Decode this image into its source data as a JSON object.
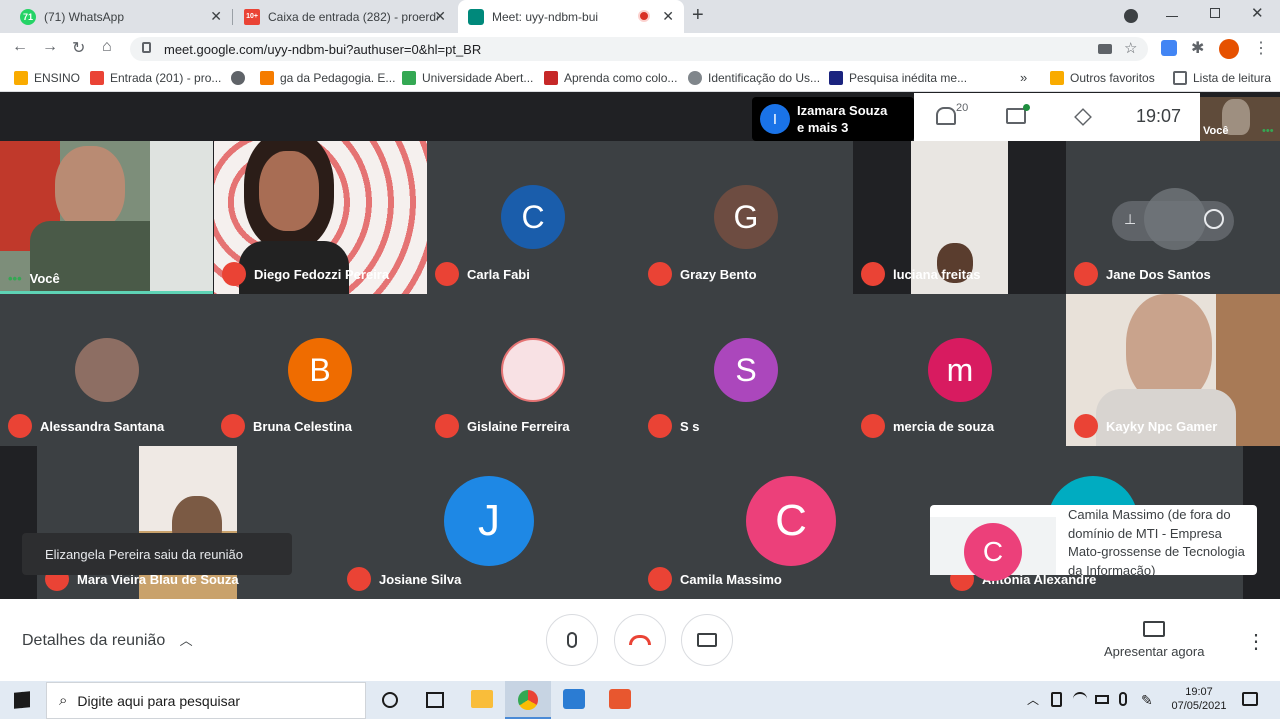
{
  "browser": {
    "tabs": [
      {
        "title": "(71) WhatsApp",
        "badge": "71"
      },
      {
        "title": "Caixa de entrada (282) - proerd@",
        "badge": "10+"
      },
      {
        "title": "Meet: uyy-ndbm-bui"
      }
    ],
    "url": "meet.google.com/uyy-ndbm-bui?authuser=0&hl=pt_BR",
    "bookmarks": [
      "ENSINO",
      "Entrada (201) - pro...",
      "ga da Pedagogia. E...",
      "Universidade Abert...",
      "Aprenda como colo...",
      "Identificação do Us...",
      "Pesquisa inédita me..."
    ],
    "more_bookmarks": "»",
    "other_favorites": "Outros favoritos",
    "reading_list": "Lista de leitura"
  },
  "meet": {
    "presenter": {
      "initial": "I",
      "name": "Izamara Souza",
      "more": "e mais 3"
    },
    "people_count": "20",
    "time": "19:07",
    "self_label": "Você",
    "participants": [
      {
        "name": "Você"
      },
      {
        "name": "Diego Fedozzi Pereira"
      },
      {
        "name": "Carla Fabi",
        "initial": "C"
      },
      {
        "name": "Grazy Bento",
        "initial": "G"
      },
      {
        "name": "luciana freitas"
      },
      {
        "name": "Jane Dos Santos"
      },
      {
        "name": "Alessandra Santana"
      },
      {
        "name": "Bruna Celestina",
        "initial": "B"
      },
      {
        "name": "Gislaine Ferreira"
      },
      {
        "name": "S s",
        "initial": "S"
      },
      {
        "name": "mercia de souza",
        "initial": "m"
      },
      {
        "name": "Kayky Npc Gamer"
      },
      {
        "name": "Mara Vieira Blau de Souza"
      },
      {
        "name": "Josiane Silva",
        "initial": "J"
      },
      {
        "name": "Camila Massimo",
        "initial": "C"
      },
      {
        "name": "Antonia Alexandre"
      }
    ],
    "left_toast": "Elizangela Pereira saiu da reunião",
    "notice": {
      "initial": "C",
      "text": "Camila Massimo (de fora do domínio de MTI - Empresa Mato-grossense de Tecnologia da Informação)"
    },
    "bottom": {
      "details": "Detalhes da reunião",
      "present": "Apresentar agora"
    }
  },
  "taskbar": {
    "search_placeholder": "Digite aqui para pesquisar",
    "time": "19:07",
    "date": "07/05/2021"
  },
  "colors": {
    "meet_bg": "#202124",
    "tile_bg": "#3c4043",
    "mic_off": "#ea4335",
    "avatar_carla": "#1a5dab",
    "avatar_grazy": "#6d4c41",
    "avatar_bruna": "#ef6c00",
    "avatar_s": "#ab47bc",
    "avatar_mercia": "#d81b60",
    "avatar_josiane": "#1e88e5",
    "avatar_camila": "#ec407a",
    "avatar_notice": "#ec407a"
  }
}
